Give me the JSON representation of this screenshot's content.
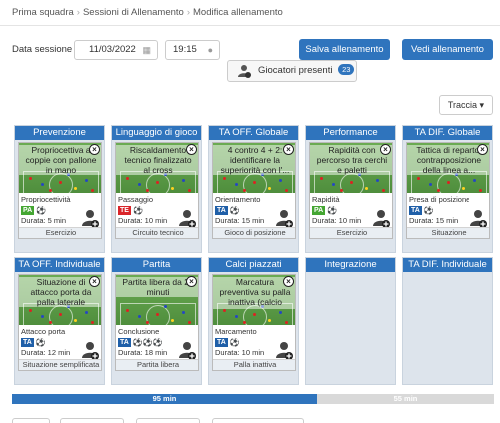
{
  "breadcrumb": [
    "Prima squadra",
    "Sessioni di Allenamento",
    "Modifica allenamento"
  ],
  "breadcrumb_separator": "›",
  "form": {
    "date_label": "Data sessione",
    "date_value": "11/03/2022",
    "time_value": "19:15",
    "date_icon": "calendar-icon",
    "time_icon": "clock-icon"
  },
  "buttons": {
    "save": "Salva allenamento",
    "view": "Vedi allenamento",
    "players": "Giocatori presenti",
    "players_count": "23",
    "track": "Traccia ▾"
  },
  "colors": {
    "accent": "#2f74bd",
    "tag_pa": "#44a632",
    "tag_te": "#d9252a",
    "tag_ta": "#1f5fa8"
  },
  "columns": [
    {
      "title": "Prevenzione",
      "cards": [
        {
          "caption": "Propriocettiva a coppie con pallone in mano",
          "category": "Propriocettività",
          "tag": "PA",
          "balls": "⚽",
          "duration": "Durata: 5 min",
          "type": "Esercizio"
        }
      ]
    },
    {
      "title": "Linguaggio di gioco",
      "cards": [
        {
          "caption": "Riscaldamento tecnico finalizzato al cross",
          "category": "Passaggio",
          "tag": "TE",
          "balls": "⚽",
          "duration": "Durata: 10 min",
          "type": "Circuito tecnico"
        }
      ]
    },
    {
      "title": "TA OFF. Globale",
      "cards": [
        {
          "caption": "4 contro 4 + 2: identificare la superiorità con l'...",
          "category": "Orientamento",
          "tag": "TA",
          "balls": "⚽",
          "duration": "Durata: 15 min",
          "type": "Gioco di posizione"
        }
      ]
    },
    {
      "title": "Performance",
      "cards": [
        {
          "caption": "Rapidità con percorso tra cerchi e paletti",
          "category": "Rapidità",
          "tag": "PA",
          "balls": "⚽",
          "duration": "Durata: 10 min",
          "type": "Esercizio"
        }
      ]
    },
    {
      "title": "TA DIF. Globale",
      "cards": [
        {
          "caption": "Tattica di reparto: contrapposizione della linea a...",
          "category": "Presa di posizione",
          "tag": "TA",
          "balls": "⚽",
          "duration": "Durata: 15 min",
          "type": "Situazione"
        }
      ]
    },
    {
      "title": "TA OFF. Individuale",
      "cards": [
        {
          "caption": "Situazione di attacco porta da palla laterale",
          "category": "Attacco porta",
          "tag": "TA",
          "balls": "⚽",
          "duration": "Durata: 12 min",
          "type": "Situazione semplificata"
        }
      ]
    },
    {
      "title": "Partita",
      "cards": [
        {
          "caption": "Partita libera da 20 minuti",
          "category": "Conclusione",
          "tag": "TA",
          "balls": "⚽⚽⚽",
          "duration": "Durata: 18 min",
          "type": "Partita libera"
        }
      ]
    },
    {
      "title": "Calci piazzati",
      "cards": [
        {
          "caption": "Marcatura preventiva su palla inattiva (calcio d'a...",
          "category": "Marcamento",
          "tag": "TA",
          "balls": "⚽",
          "duration": "Durata: 10 min",
          "type": "Palla inattiva"
        }
      ]
    },
    {
      "title": "Integrazione",
      "cards": []
    },
    {
      "title": "TA DIF. Individuale",
      "cards": []
    }
  ],
  "progress": {
    "used_label": "95 min",
    "remaining_label": "55 min",
    "used_fraction": 0.633
  }
}
